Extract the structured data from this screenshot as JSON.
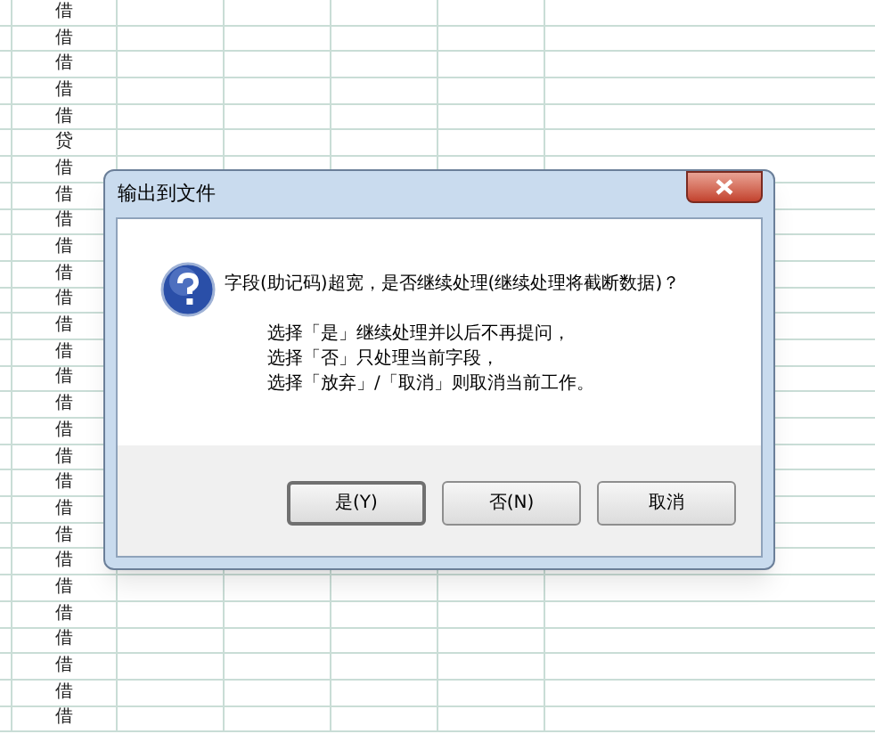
{
  "sheet": {
    "rows": [
      "借",
      "借",
      "借",
      "借",
      "借",
      "贷",
      "借",
      "借",
      "借",
      "借",
      "借",
      "借",
      "借",
      "借",
      "借",
      "借",
      "借",
      "借",
      "借",
      "借",
      "借",
      "借",
      "借",
      "借",
      "借",
      "借",
      "借",
      "借"
    ]
  },
  "dialog": {
    "title": "输出到文件",
    "message": "字段(助记码)超宽，是否继续处理(继续处理将截断数据)？",
    "details": [
      "选择「是」继续处理并以后不再提问，",
      "选择「否」只处理当前字段，",
      "选择「放弃」/「取消」则取消当前工作。"
    ],
    "buttons": [
      {
        "label": "是(Y)",
        "selected": true
      },
      {
        "label": "否(N)",
        "selected": false
      },
      {
        "label": "取消",
        "selected": false
      }
    ]
  }
}
